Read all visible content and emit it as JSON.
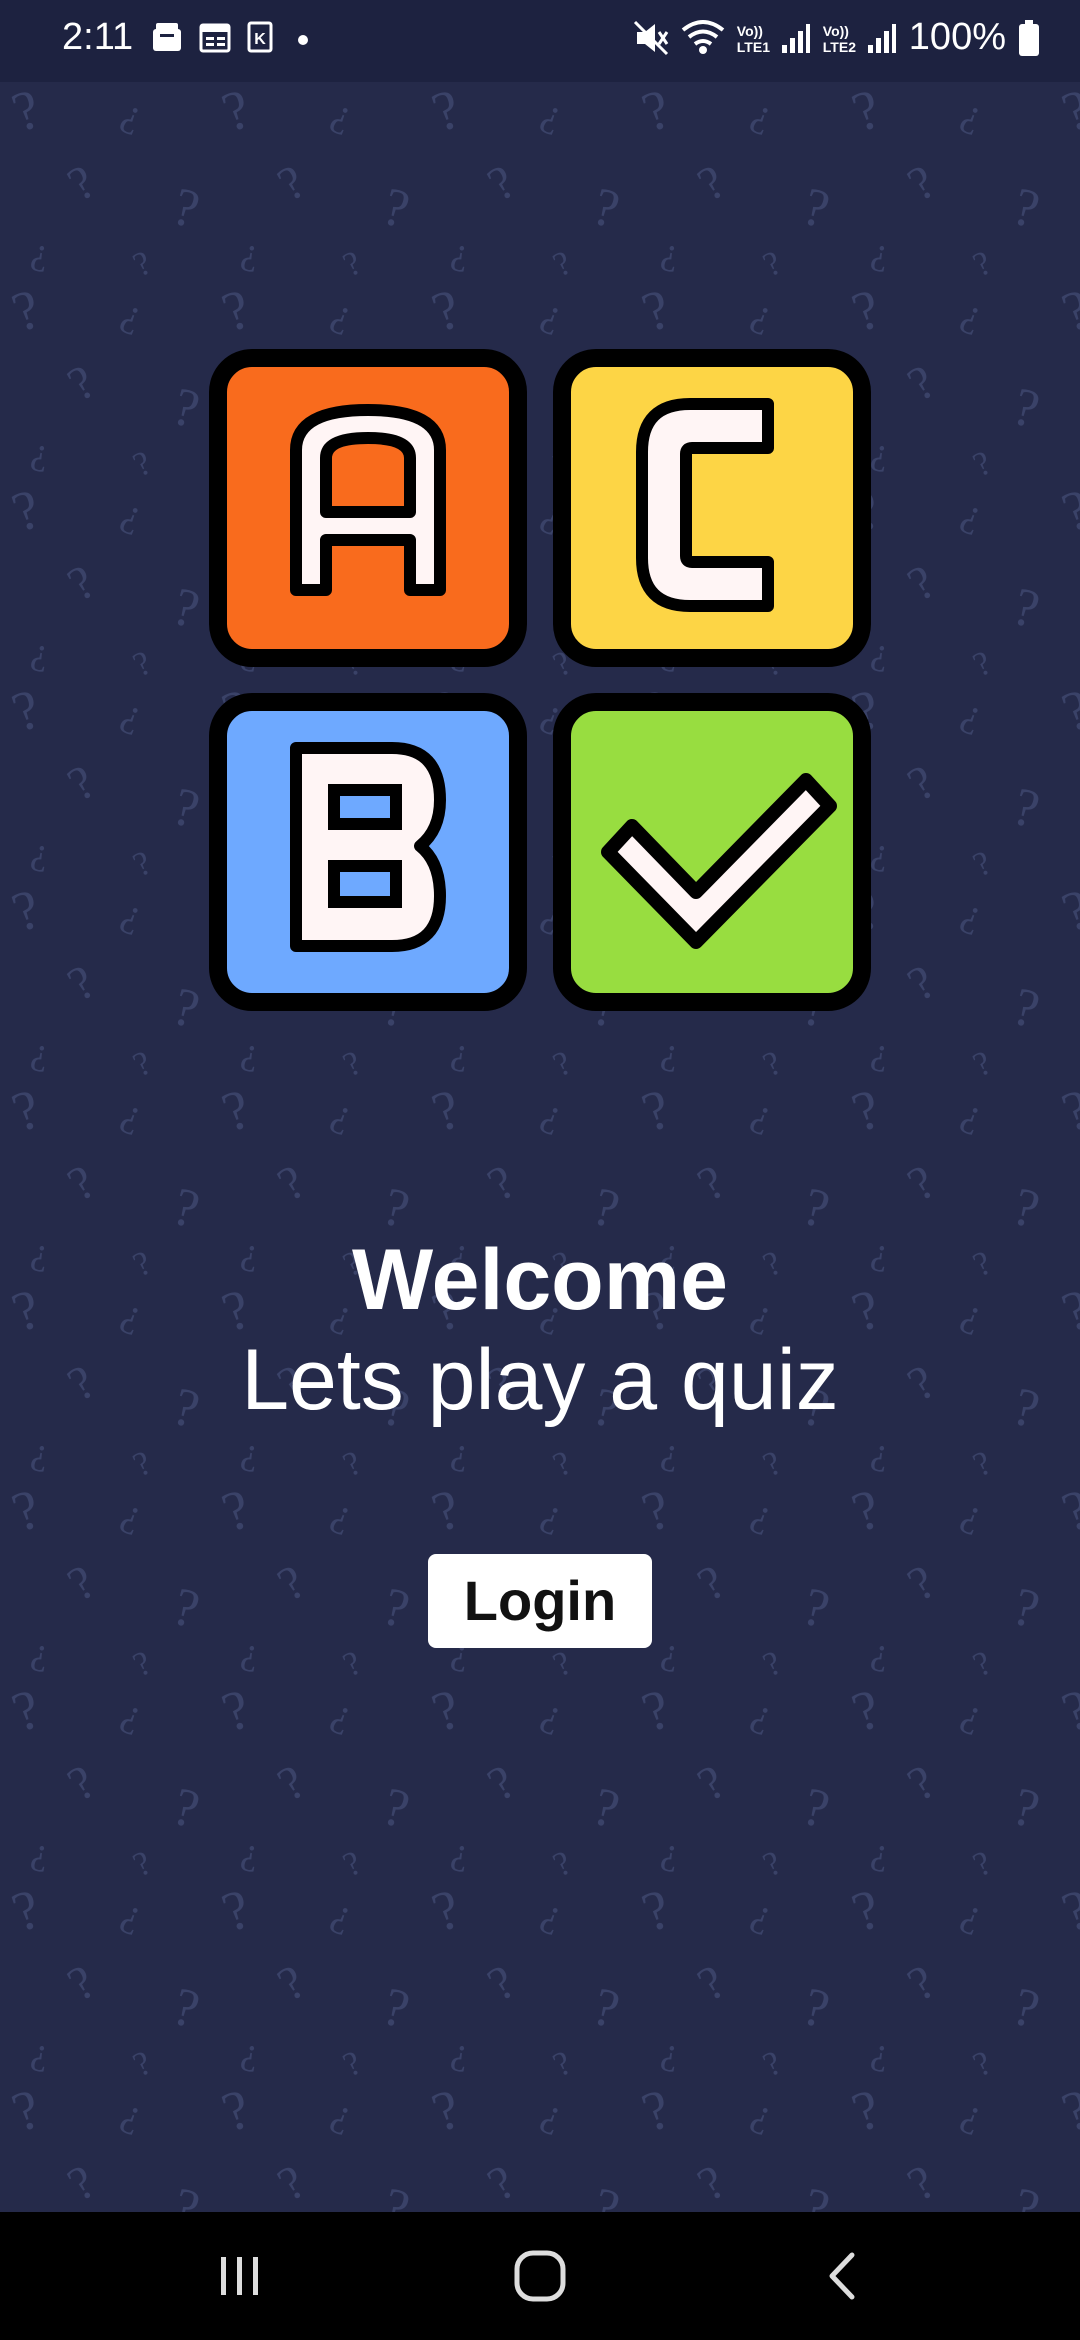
{
  "status_bar": {
    "time": "2:11",
    "battery": "100%",
    "icons": [
      "notification-icon",
      "calendar-icon",
      "k-icon",
      "dot-icon",
      "mute-icon",
      "wifi-icon",
      "lte1-signal-icon",
      "lte2-signal-icon",
      "battery-icon"
    ],
    "lte1": "Vo)) LTE1",
    "lte2": "Vo)) LTE2"
  },
  "logo": {
    "tiles": [
      {
        "letter": "A",
        "color": "#f96b1d"
      },
      {
        "letter": "C",
        "color": "#fdd545"
      },
      {
        "letter": "B",
        "color": "#6ea9ff"
      },
      {
        "letter": "check",
        "color": "#98dd40"
      }
    ]
  },
  "main": {
    "welcome": "Welcome",
    "subtitle": "Lets play a quiz",
    "login_label": "Login"
  },
  "nav_bar": {
    "buttons": [
      "recent-apps-icon",
      "home-icon",
      "back-icon"
    ]
  },
  "colors": {
    "background": "#252a4a",
    "status_bar": "#1d2240",
    "pattern": "#3a4268",
    "nav_bar": "#000000"
  }
}
